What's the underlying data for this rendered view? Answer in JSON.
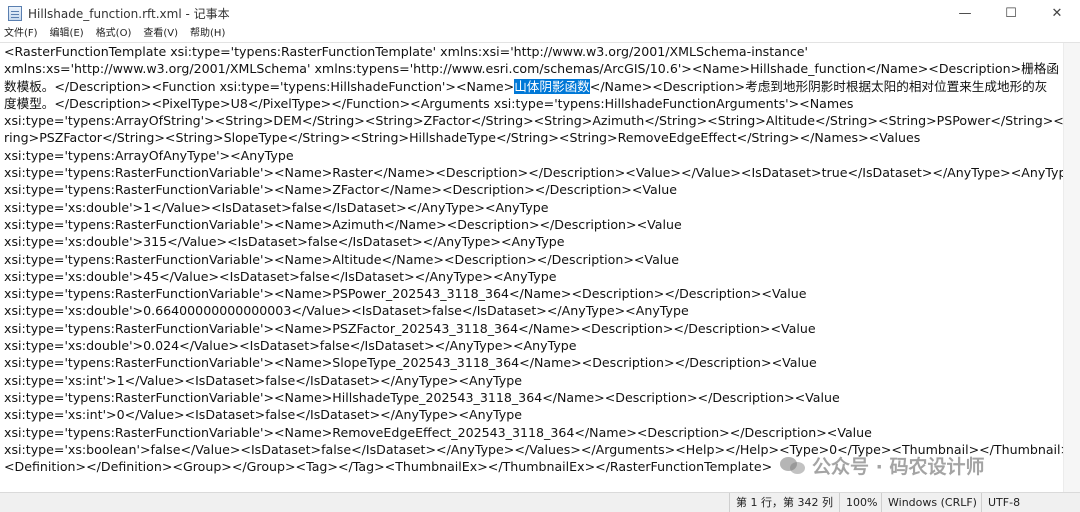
{
  "window": {
    "title": "Hillshade_function.rft.xml - 记事本",
    "min_glyph": "—",
    "max_glyph": "☐",
    "close_glyph": "✕"
  },
  "menu": [
    "文件(F)",
    "编辑(E)",
    "格式(O)",
    "查看(V)",
    "帮助(H)"
  ],
  "content": {
    "line_1": "<RasterFunctionTemplate xsi:type='typens:RasterFunctionTemplate' xmlns:xsi='http://www.w3.org/2001/XMLSchema-instance'",
    "line_2": "xmlns:xs='http://www.w3.org/2001/XMLSchema' xmlns:typens='http://www.esri.com/schemas/ArcGIS/10.6'><Name>Hillshade_function</Name><Description>栅格函",
    "line_3a": "数模板。</Description><Function xsi:type='typens:HillshadeFunction'><Name>",
    "line_3_selected": "山体阴影函数",
    "line_3b": "</Name><Description>考虑到地形阴影时根据太阳的相对位置来生成地形的灰",
    "line_4": "度模型。</Description><PixelType>U8</PixelType></Function><Arguments xsi:type='typens:HillshadeFunctionArguments'><Names",
    "line_5": "xsi:type='typens:ArrayOfString'><String>DEM</String><String>ZFactor</String><String>Azimuth</String><String>Altitude</String><String>PSPower</String><St",
    "line_6": "ring>PSZFactor</String><String>SlopeType</String><String>HillshadeType</String><String>RemoveEdgeEffect</String></Names><Values",
    "line_7": "xsi:type='typens:ArrayOfAnyType'><AnyType",
    "line_8": "xsi:type='typens:RasterFunctionVariable'><Name>Raster</Name><Description></Description><Value></Value><IsDataset>true</IsDataset></AnyType><AnyType",
    "line_9": "xsi:type='typens:RasterFunctionVariable'><Name>ZFactor</Name><Description></Description><Value",
    "line_10": "xsi:type='xs:double'>1</Value><IsDataset>false</IsDataset></AnyType><AnyType",
    "line_11": "xsi:type='typens:RasterFunctionVariable'><Name>Azimuth</Name><Description></Description><Value",
    "line_12": "xsi:type='xs:double'>315</Value><IsDataset>false</IsDataset></AnyType><AnyType",
    "line_13": "xsi:type='typens:RasterFunctionVariable'><Name>Altitude</Name><Description></Description><Value",
    "line_14": "xsi:type='xs:double'>45</Value><IsDataset>false</IsDataset></AnyType><AnyType",
    "line_15": "xsi:type='typens:RasterFunctionVariable'><Name>PSPower_202543_3118_364</Name><Description></Description><Value",
    "line_16": "xsi:type='xs:double'>0.66400000000000003</Value><IsDataset>false</IsDataset></AnyType><AnyType",
    "line_17": "xsi:type='typens:RasterFunctionVariable'><Name>PSZFactor_202543_3118_364</Name><Description></Description><Value",
    "line_18": "xsi:type='xs:double'>0.024</Value><IsDataset>false</IsDataset></AnyType><AnyType",
    "line_19": "xsi:type='typens:RasterFunctionVariable'><Name>SlopeType_202543_3118_364</Name><Description></Description><Value",
    "line_20": "xsi:type='xs:int'>1</Value><IsDataset>false</IsDataset></AnyType><AnyType",
    "line_21": "xsi:type='typens:RasterFunctionVariable'><Name>HillshadeType_202543_3118_364</Name><Description></Description><Value",
    "line_22": "xsi:type='xs:int'>0</Value><IsDataset>false</IsDataset></AnyType><AnyType",
    "line_23": "xsi:type='typens:RasterFunctionVariable'><Name>RemoveEdgeEffect_202543_3118_364</Name><Description></Description><Value",
    "line_24": "xsi:type='xs:boolean'>false</Value><IsDataset>false</IsDataset></AnyType></Values></Arguments><Help></Help><Type>0</Type><Thumbnail></Thumbnail>",
    "line_25": "<Definition></Definition><Group></Group><Tag></Tag><ThumbnailEx></ThumbnailEx></RasterFunctionTemplate>"
  },
  "status": {
    "position": "第 1 行，第 342 列",
    "zoom": "100%",
    "line_ending": "Windows (CRLF)",
    "encoding": "UTF-8"
  },
  "watermark": {
    "text": "公众号 · 码农设计师"
  }
}
